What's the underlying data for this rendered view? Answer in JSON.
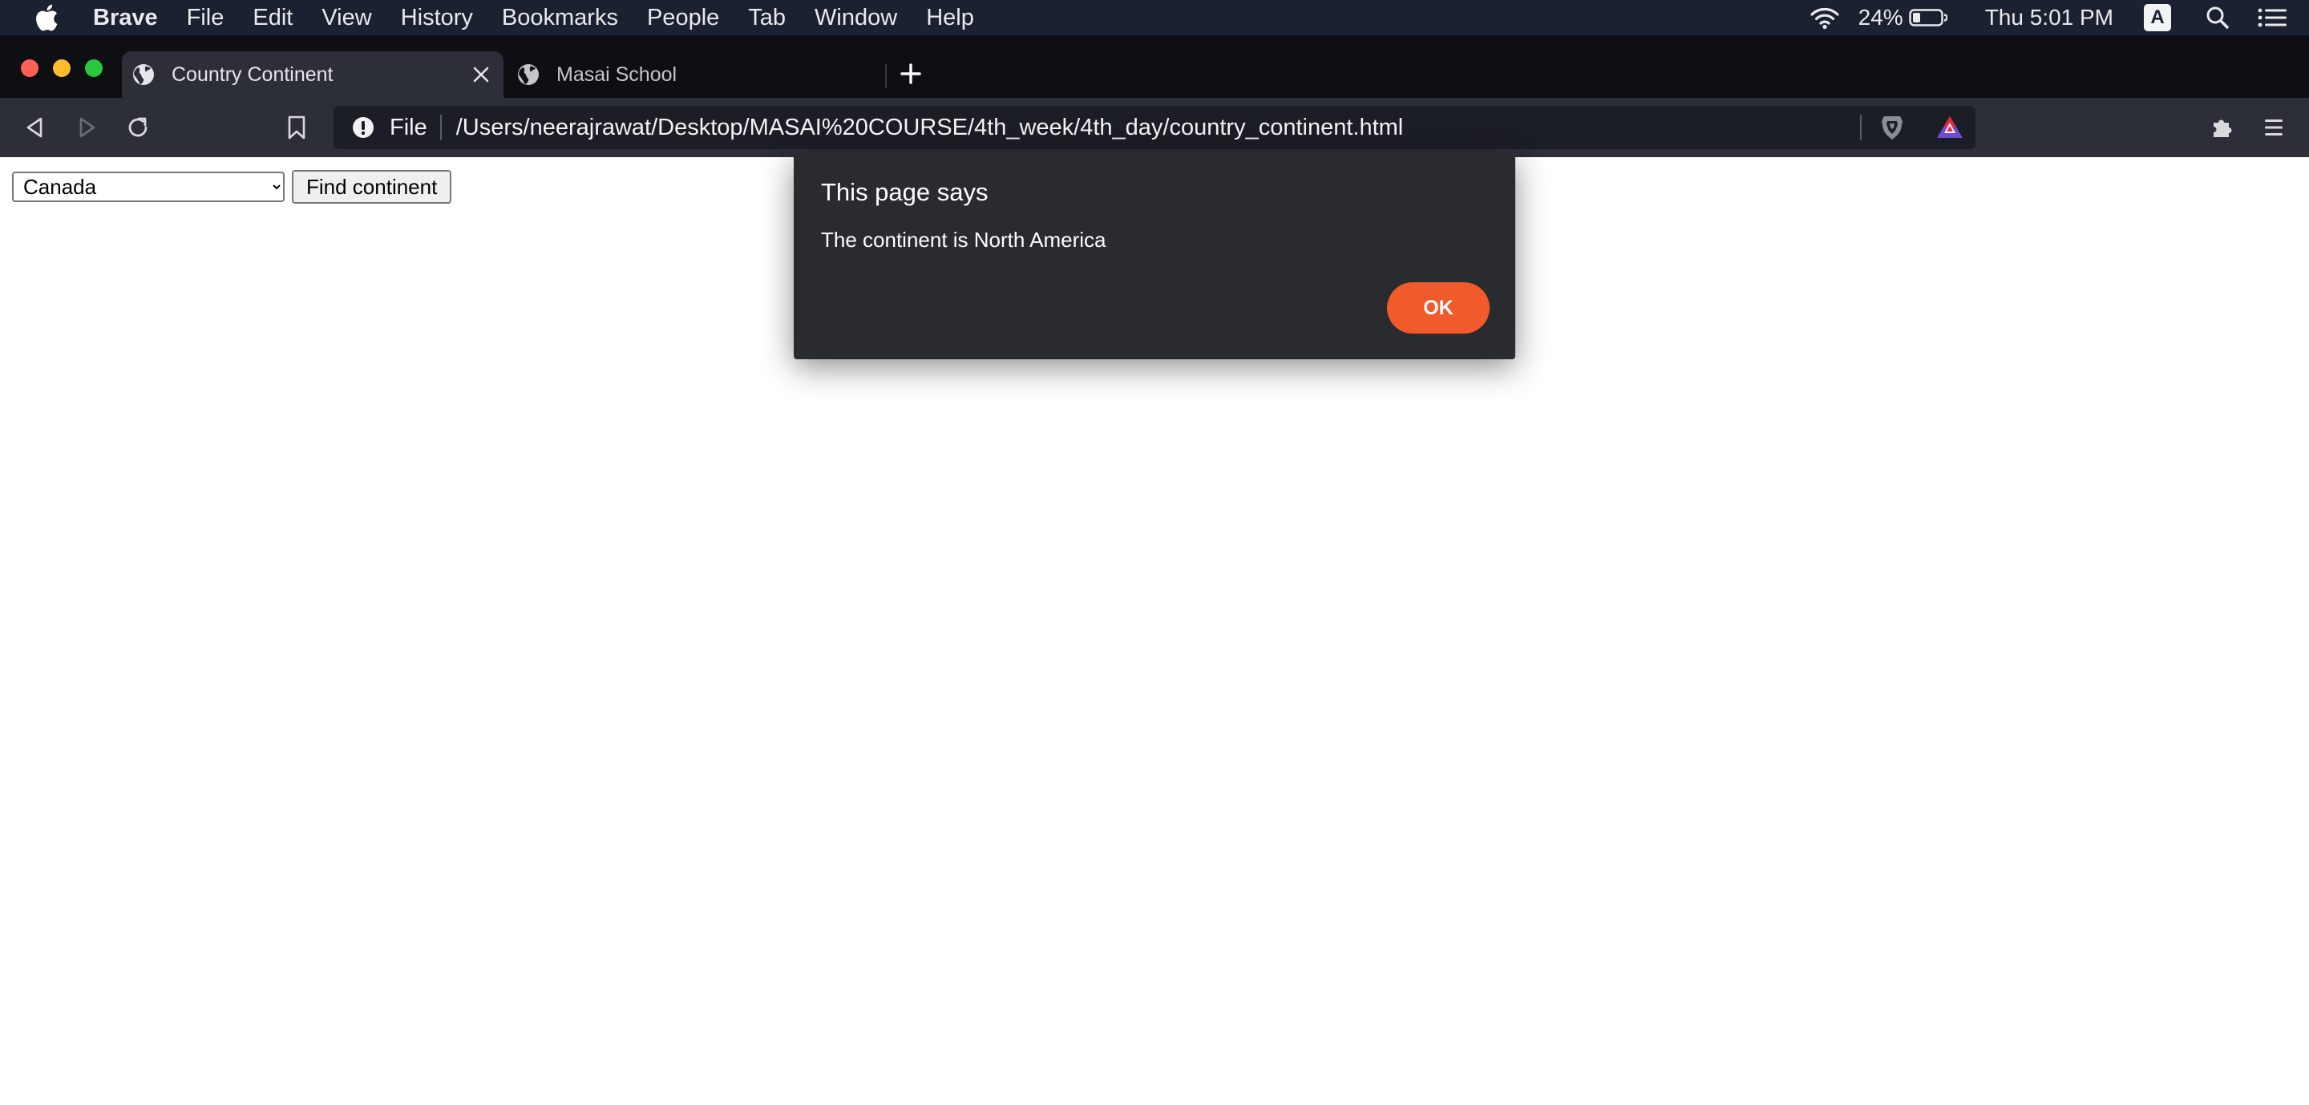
{
  "menubar": {
    "app_name": "Brave",
    "items": [
      "File",
      "Edit",
      "View",
      "History",
      "Bookmarks",
      "People",
      "Tab",
      "Window",
      "Help"
    ],
    "battery": "24%",
    "clock": "Thu 5:01 PM",
    "input_source": "A"
  },
  "tabs": [
    {
      "title": "Country Continent",
      "active": true
    },
    {
      "title": "Masai School",
      "active": false
    }
  ],
  "toolbar": {
    "scheme_label": "File",
    "url": "/Users/neerajrawat/Desktop/MASAI%20COURSE/4th_week/4th_day/country_continent.html"
  },
  "page": {
    "selected_country": "Canada",
    "find_button_label": "Find continent"
  },
  "dialog": {
    "title": "This page says",
    "message": "The continent is North America",
    "ok_label": "OK"
  },
  "colors": {
    "menubar_bg": "#1c2132",
    "accent": "#f15a2b"
  }
}
